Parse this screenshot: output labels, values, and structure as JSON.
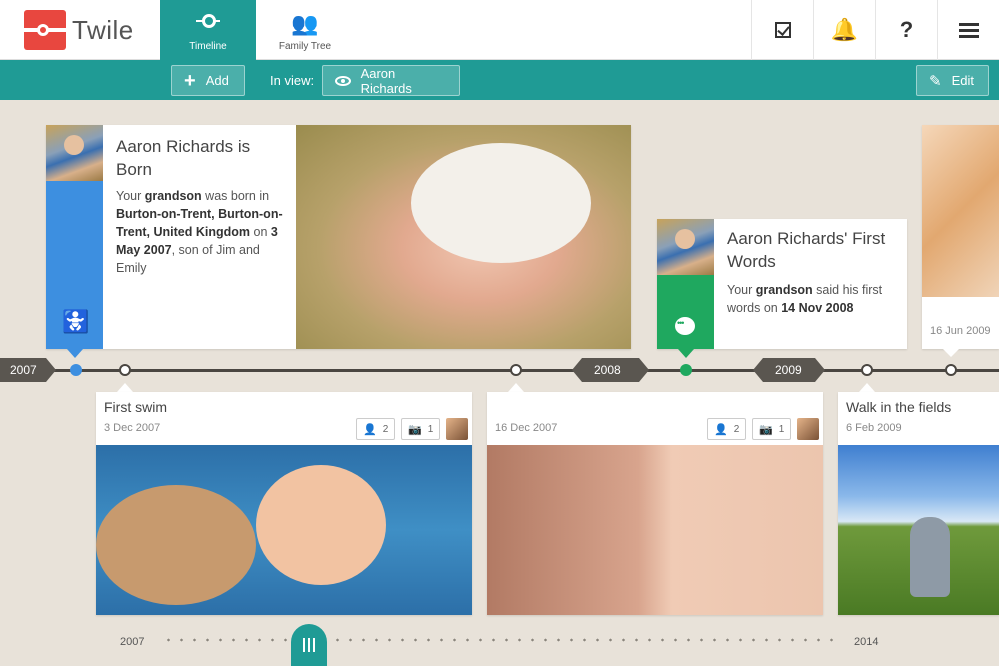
{
  "app": {
    "brand": "Twile"
  },
  "nav": {
    "tabs": [
      {
        "label": "Timeline",
        "icon": "timeline-icon",
        "active": true
      },
      {
        "label": "Family Tree",
        "icon": "family-tree-icon",
        "active": false
      }
    ],
    "right_buttons": [
      "checklist-icon",
      "bell-icon",
      "help-icon",
      "menu-icon"
    ],
    "help_glyph": "?"
  },
  "toolbar": {
    "add_label": "Add",
    "in_view_label": "In view:",
    "person_label": "Aaron Richards",
    "edit_label": "Edit"
  },
  "events": {
    "born": {
      "title": "Aaron Richards is Born",
      "desc_parts": [
        "Your ",
        "grandson",
        " was born in ",
        "Burton-on-Trent, Burton-on-Trent, United Kingdom",
        " on ",
        "3 May 2007",
        ", son of Jim and Emily"
      ],
      "accent": "#3d8fe0",
      "icon": "pram-icon"
    },
    "first_words": {
      "title": "Aaron Richards' First Words",
      "desc_parts": [
        "Your ",
        "grandson",
        " said his first words on ",
        "14 Nov 2008"
      ],
      "accent": "#1fa85f",
      "icon": "speech-bubble-icon"
    },
    "side_date": "16 Jun 2009"
  },
  "cards": [
    {
      "title": "First swim",
      "date": "3 Dec 2007",
      "people": "2",
      "photos": "1"
    },
    {
      "title": "",
      "date": "16 Dec 2007",
      "people": "2",
      "photos": "1"
    },
    {
      "title": "Walk in the fields",
      "date": "6 Feb 2009"
    }
  ],
  "timeline": {
    "years": [
      "2007",
      "2008",
      "2009"
    ]
  },
  "scrubber": {
    "start": "2007",
    "end": "2014"
  },
  "colors": {
    "teal": "#1f9b95",
    "logo_red": "#e8473f",
    "blue": "#3d8fe0",
    "green": "#1fa85f"
  }
}
